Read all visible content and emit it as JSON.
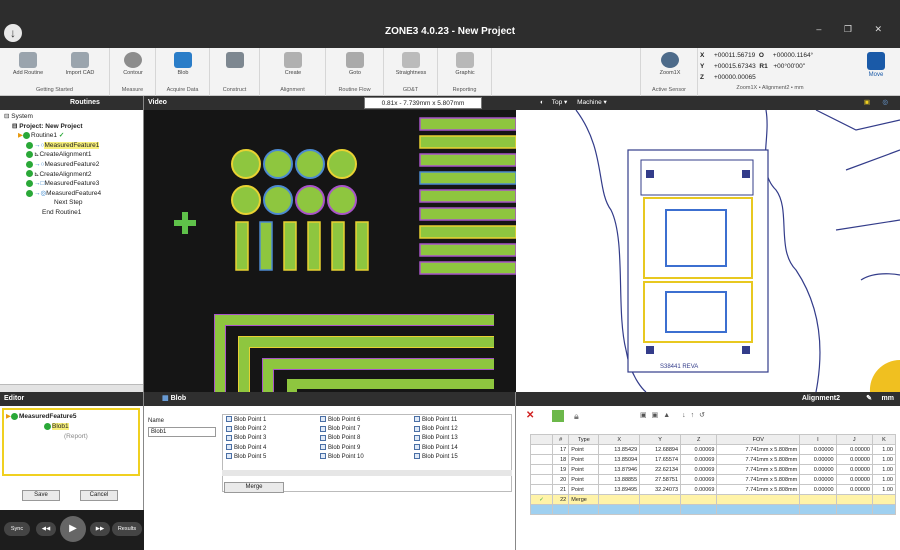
{
  "app": {
    "title": "ZONE3 4.0.23 - New Project",
    "menu_glyph": "↓",
    "window_buttons": "– ❐ ✕"
  },
  "ribbon": {
    "groups": [
      {
        "label": "Getting Started",
        "buttons": [
          "Add Routine",
          "Import CAD"
        ]
      },
      {
        "label": "Measure",
        "buttons": [
          "Contour"
        ]
      },
      {
        "label": "Acquire Data",
        "buttons": [
          "Blob"
        ]
      },
      {
        "label": "Construct",
        "buttons": [
          ""
        ]
      },
      {
        "label": "Alignment",
        "buttons": [
          "Create"
        ]
      },
      {
        "label": "Routine Flow",
        "buttons": [
          "Goto"
        ]
      },
      {
        "label": "GD&T",
        "buttons": [
          "Straightness"
        ]
      },
      {
        "label": "Reporting",
        "buttons": [
          "Graphic"
        ]
      },
      {
        "label": "Active Sensor",
        "buttons": [
          "Zoom1X"
        ]
      }
    ],
    "coords": {
      "x_label": "X",
      "x_value": "+00011.56719",
      "y_label": "Y",
      "y_value": "+00015.67343",
      "z_label": "Z",
      "z_value": "+00000.00065",
      "o_label": "O",
      "o_value": "+00000.1164°",
      "r_label": "R1",
      "r_value": "+00°00'00\"",
      "status": "Zoom1X • Alignment2 • mm"
    },
    "move_label": "Move",
    "icons": [
      "add-routine-icon",
      "import-cad-icon",
      "contour-icon",
      "blob-icon",
      "construct-icon",
      "create-alignment-icon",
      "goto-icon",
      "straightness-icon",
      "graphic-icon",
      "zoom-sensor-icon",
      "move-icon"
    ],
    "accent": "#1a5aa8"
  },
  "routines": {
    "header": "Routines",
    "items": [
      {
        "label": "System"
      },
      {
        "label": "Project: New Project"
      },
      {
        "label": "Routine1"
      },
      {
        "label": "MeasuredFeature1"
      },
      {
        "label": "CreateAlignment1"
      },
      {
        "label": "MeasuredFeature2"
      },
      {
        "label": "CreateAlignment2"
      },
      {
        "label": "MeasuredFeature3"
      },
      {
        "label": "MeasuredFeature4"
      },
      {
        "label": "Next Step"
      },
      {
        "label": "End Routine1"
      }
    ],
    "ok_mark": "✓"
  },
  "video": {
    "header": "Video",
    "zoom": "0.81x - 7.739mm x 5.807mm"
  },
  "cad": {
    "view": "Top",
    "frame": "Machine",
    "part_label": "S38441 REVA"
  },
  "editor": {
    "header": "Editor",
    "feature": "MeasuredFeature5",
    "blob": "Blob1",
    "report": "(Report)",
    "save": "Save",
    "cancel": "Cancel",
    "transport": {
      "sync": "Sync",
      "rew": "◀◀",
      "play": "▶",
      "ff": "▶▶",
      "results": "Results"
    }
  },
  "blob": {
    "header": "Blob",
    "name_label": "Name",
    "name_value": "Blob1",
    "points": [
      "Blob Point 1",
      "Blob Point 2",
      "Blob Point 3",
      "Blob Point 4",
      "Blob Point 5",
      "Blob Point 6",
      "Blob Point 7",
      "Blob Point 8",
      "Blob Point 9",
      "Blob Point 10",
      "Blob Point 11",
      "Blob Point 12",
      "Blob Point 13",
      "Blob Point 14",
      "Blob Point 15"
    ],
    "merge": "Merge"
  },
  "alignment": {
    "header": "Alignment2",
    "units": "mm",
    "columns": [
      "#",
      "Type",
      "X",
      "Y",
      "Z",
      "FOV",
      "I",
      "J",
      "K"
    ],
    "rows": [
      [
        "17",
        "Point",
        "13.85429",
        "12.68894",
        "0.00069",
        "7.741mm x 5.808mm",
        "0.00000",
        "0.00000",
        "1.00"
      ],
      [
        "18",
        "Point",
        "13.85094",
        "17.65574",
        "0.00069",
        "7.741mm x 5.808mm",
        "0.00000",
        "0.00000",
        "1.00"
      ],
      [
        "19",
        "Point",
        "13.87946",
        "22.62134",
        "0.00069",
        "7.741mm x 5.808mm",
        "0.00000",
        "0.00000",
        "1.00"
      ],
      [
        "20",
        "Point",
        "13.88855",
        "27.58751",
        "0.00069",
        "7.741mm x 5.808mm",
        "0.00000",
        "0.00000",
        "1.00"
      ],
      [
        "21",
        "Point",
        "13.89495",
        "32.24073",
        "0.00069",
        "7.741mm x 5.808mm",
        "0.00000",
        "0.00000",
        "1.00"
      ],
      [
        "22",
        "Merge",
        "",
        "",
        "",
        "",
        "",
        "",
        ""
      ]
    ]
  }
}
